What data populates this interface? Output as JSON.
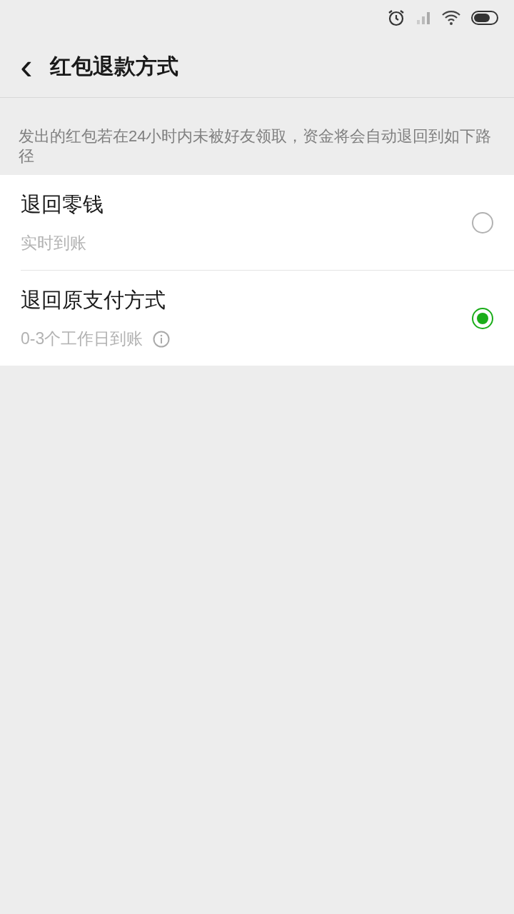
{
  "nav_bar": {
    "back": "‹",
    "title": "红包退款方式"
  },
  "description": "发出的红包若在24小时内未被好友领取，资金将会自动退回到如下路径",
  "options": [
    {
      "title": "退回零钱",
      "subtitle": "实时到账",
      "selected": false,
      "info": false
    },
    {
      "title": "退回原支付方式",
      "subtitle": "0-3个工作日到账",
      "selected": true,
      "info": true
    }
  ]
}
